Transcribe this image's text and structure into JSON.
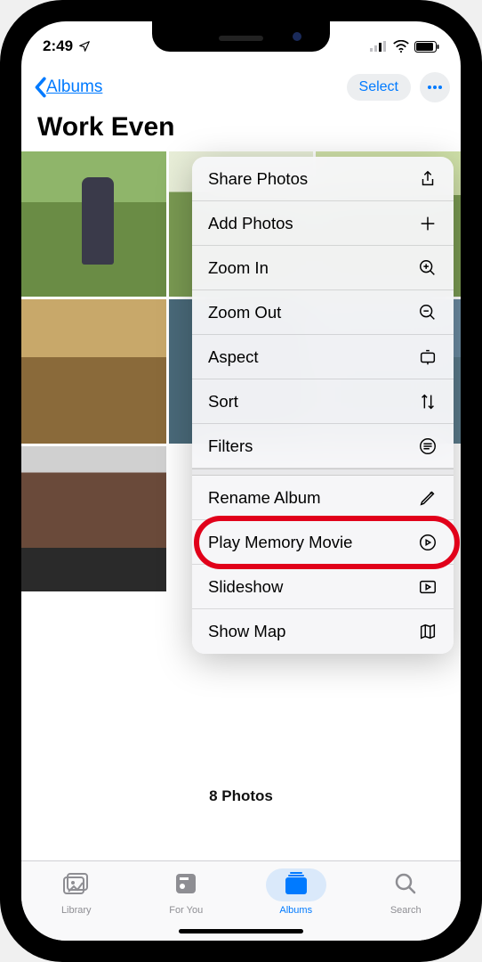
{
  "status": {
    "time": "2:49"
  },
  "nav": {
    "back_label": "Albums",
    "select_label": "Select"
  },
  "album": {
    "title": "Work Even",
    "count_label": "8 Photos"
  },
  "menu": {
    "share": "Share Photos",
    "add": "Add Photos",
    "zoom_in": "Zoom In",
    "zoom_out": "Zoom Out",
    "aspect": "Aspect",
    "sort": "Sort",
    "filters": "Filters",
    "rename": "Rename Album",
    "play_memory": "Play Memory Movie",
    "slideshow": "Slideshow",
    "show_map": "Show Map"
  },
  "tabs": {
    "library": "Library",
    "for_you": "For You",
    "albums": "Albums",
    "search": "Search"
  }
}
